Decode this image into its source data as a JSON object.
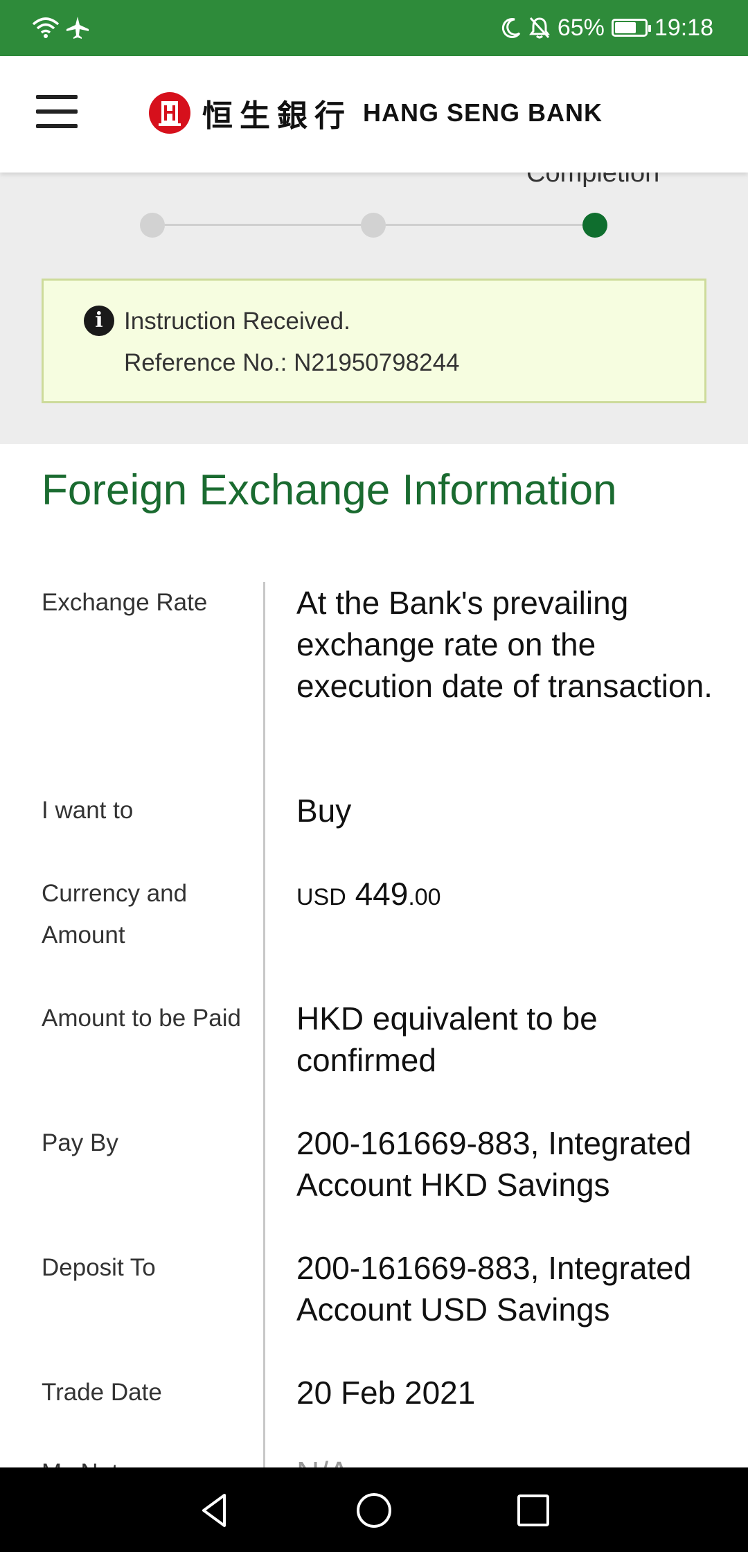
{
  "status_bar": {
    "battery_text": "65%",
    "battery_level": 0.65,
    "time": "19:18",
    "icons": [
      "wifi-icon",
      "airplane-icon",
      "moon-icon",
      "mute-icon",
      "battery-icon"
    ]
  },
  "header": {
    "logo_chinese": "恒生銀行",
    "logo_english": "HANG SENG BANK",
    "menu_icon": "hamburger-menu-icon"
  },
  "progress": {
    "visible_step_label": "Completion",
    "total_steps": 3,
    "current_step": 3
  },
  "notice": {
    "icon": "info-icon",
    "line1": "Instruction Received.",
    "line2": "Reference No.: N21950798244"
  },
  "section": {
    "title": "Foreign Exchange Information"
  },
  "details": {
    "exchange_rate": {
      "label": "Exchange Rate",
      "value": "At the Bank's prevailing exchange rate on the execution date of transaction."
    },
    "want_to": {
      "label": "I want to",
      "value": "Buy"
    },
    "currency_amount": {
      "label": "Currency and Amount",
      "currency": "USD",
      "integer": "449",
      "decimal": ".00"
    },
    "amount_paid": {
      "label": "Amount to be Paid",
      "value": "HKD equivalent to be confirmed"
    },
    "pay_by": {
      "label": "Pay By",
      "value": "200-161669-883, Integrated Account HKD Savings"
    },
    "deposit_to": {
      "label": "Deposit To",
      "value": "200-161669-883, Integrated Account USD Savings"
    },
    "trade_date": {
      "label": "Trade Date",
      "value": "20 Feb 2021"
    },
    "partial_next": {
      "label": "My Note",
      "value": "N/A"
    }
  },
  "nav": {
    "icons": [
      "back-icon",
      "home-icon",
      "recents-icon"
    ]
  },
  "colors": {
    "status_bar": "#2e8b3a",
    "brand_green": "#1a6b30",
    "active_step": "#0f6e2e",
    "notice_bg": "#f6fde0",
    "notice_border": "#cddb9a",
    "logo_red": "#d6101c"
  }
}
